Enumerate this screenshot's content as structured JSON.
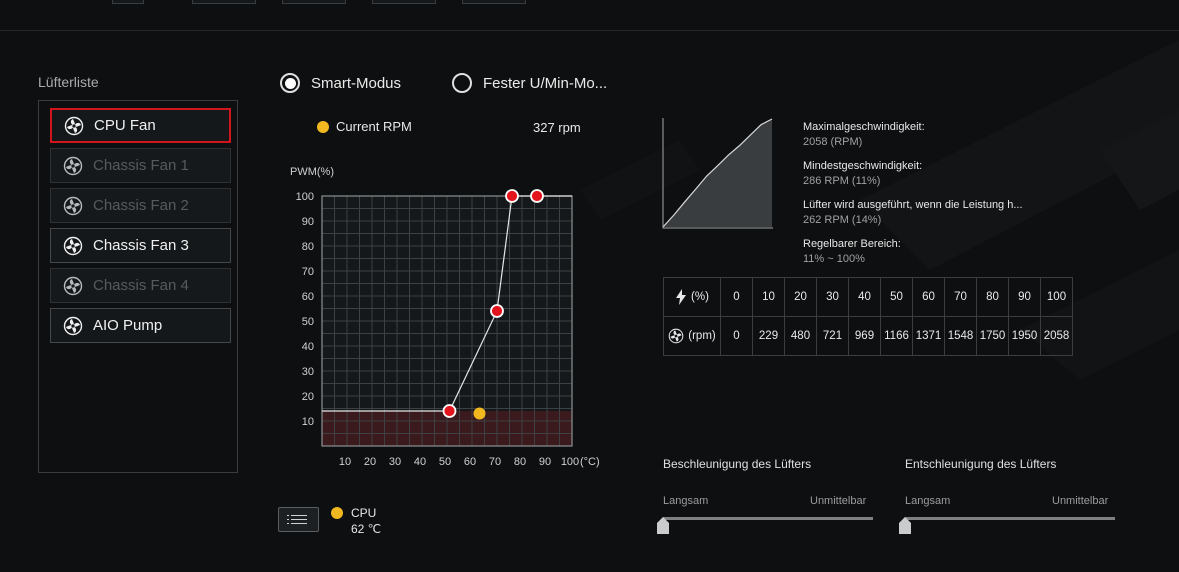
{
  "fan_list": {
    "title": "Lüfterliste",
    "items": [
      {
        "label": "CPU Fan",
        "state": "selected"
      },
      {
        "label": "Chassis Fan 1",
        "state": "disabled"
      },
      {
        "label": "Chassis Fan 2",
        "state": "disabled"
      },
      {
        "label": "Chassis Fan 3",
        "state": "normal"
      },
      {
        "label": "Chassis Fan 4",
        "state": "disabled"
      },
      {
        "label": "AIO Pump",
        "state": "normal"
      }
    ]
  },
  "modes": {
    "smart": {
      "label": "Smart-Modus",
      "selected": true
    },
    "fixed": {
      "label": "Fester U/Min-Mo...",
      "selected": false
    }
  },
  "current_rpm": {
    "label": "Current RPM",
    "value": "327 rpm"
  },
  "chart_data": {
    "type": "line",
    "ylabel": "PWM(%)",
    "xunit": "(°C)",
    "xlim": [
      0,
      100
    ],
    "ylim": [
      0,
      100
    ],
    "x_ticks": [
      10,
      20,
      30,
      40,
      50,
      60,
      70,
      80,
      90,
      100
    ],
    "y_ticks": [
      10,
      20,
      30,
      40,
      50,
      60,
      70,
      80,
      90,
      100
    ],
    "grid": true,
    "curve_points": [
      {
        "x": 0,
        "y": 14
      },
      {
        "x": 51,
        "y": 14
      },
      {
        "x": 70,
        "y": 54
      },
      {
        "x": 76,
        "y": 100
      },
      {
        "x": 86,
        "y": 100
      },
      {
        "x": 100,
        "y": 100
      }
    ],
    "control_points": [
      {
        "x": 51,
        "y": 14
      },
      {
        "x": 70,
        "y": 54
      },
      {
        "x": 76,
        "y": 100
      },
      {
        "x": 86,
        "y": 100
      }
    ],
    "current_point": {
      "x": 63,
      "y": 13
    },
    "min_zone_pwm": 14,
    "colors": {
      "control": "#e3141b",
      "current": "#f2b81f",
      "zone": "#3a1a1c"
    }
  },
  "temp_source": {
    "label": "CPU",
    "temp": "62 ℃"
  },
  "speed_info": [
    {
      "label": "Maximalgeschwindigkeit:",
      "value": "2058 (RPM)"
    },
    {
      "label": "Mindestgeschwindigkeit:",
      "value": "286 RPM (11%)"
    },
    {
      "label": "Lüfter wird ausgeführt, wenn die Leistung h...",
      "value": "262 RPM (14%)"
    },
    {
      "label": "Regelbarer Bereich:",
      "value": "11% ~ 100%"
    }
  ],
  "rpm_curve_mini": {
    "points": [
      {
        "pct": 0,
        "rpm": 0
      },
      {
        "pct": 10,
        "rpm": 229
      },
      {
        "pct": 20,
        "rpm": 480
      },
      {
        "pct": 30,
        "rpm": 721
      },
      {
        "pct": 40,
        "rpm": 969
      },
      {
        "pct": 50,
        "rpm": 1166
      },
      {
        "pct": 60,
        "rpm": 1371
      },
      {
        "pct": 70,
        "rpm": 1548
      },
      {
        "pct": 80,
        "rpm": 1750
      },
      {
        "pct": 90,
        "rpm": 1950
      },
      {
        "pct": 100,
        "rpm": 2058
      }
    ]
  },
  "rpm_table": {
    "pct_label": "(%)",
    "rpm_label": "(rpm)",
    "pct": [
      "0",
      "10",
      "20",
      "30",
      "40",
      "50",
      "60",
      "70",
      "80",
      "90",
      "100"
    ],
    "rpm": [
      "0",
      "229",
      "480",
      "721",
      "969",
      "1166",
      "1371",
      "1548",
      "1750",
      "1950",
      "2058"
    ]
  },
  "accel": {
    "title": "Beschleunigung des Lüfters",
    "min_label": "Langsam",
    "max_label": "Unmittelbar",
    "value": 0
  },
  "decel": {
    "title": "Entschleunigung des Lüfters",
    "min_label": "Langsam",
    "max_label": "Unmittelbar",
    "value": 0
  }
}
